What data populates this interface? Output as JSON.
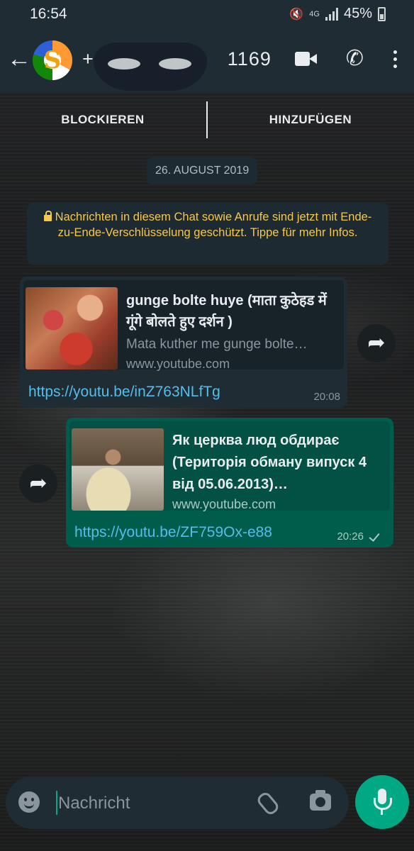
{
  "status_bar": {
    "time": "16:54",
    "network": "4G",
    "battery": "45%"
  },
  "header": {
    "back_icon": "arrow-left-icon",
    "avatar_letter": "S",
    "contact_visible": "+4",
    "contact_tail": "1169"
  },
  "actions": {
    "block": "BLOCKIEREN",
    "add": "HINZUFÜGEN"
  },
  "date_chip": "26. AUGUST 2019",
  "encryption_notice": "Nachrichten in diesem Chat sowie Anrufe sind jetzt mit Ende-zu-Ende-Verschlüsselung geschützt. Tippe für mehr Infos.",
  "messages": [
    {
      "direction": "incoming",
      "preview_title": "gunge bolte huye (माता कुठेहड में गूंगे बोलते हुए दर्शन )",
      "preview_description": "Mata kuther me gunge bolte…",
      "preview_domain": "www.youtube.com",
      "link": "https://youtu.be/inZ763NLfTg",
      "time": "20:08"
    },
    {
      "direction": "outgoing",
      "preview_title": "Як церква люд обдирає (Територія обману випуск 4 від 05.06.2013)…",
      "preview_domain": "www.youtube.com",
      "link": "https://youtu.be/ZF759Ox-e88",
      "time": "20:26",
      "status": "sent"
    }
  ],
  "composer": {
    "placeholder": "Nachricht"
  },
  "colors": {
    "header": "#1f2c34",
    "incoming_bubble": "#1f2c34",
    "outgoing_bubble": "#005c4b",
    "link": "#53bdeb",
    "accent": "#00a884",
    "notice_text": "#f5c84c"
  }
}
